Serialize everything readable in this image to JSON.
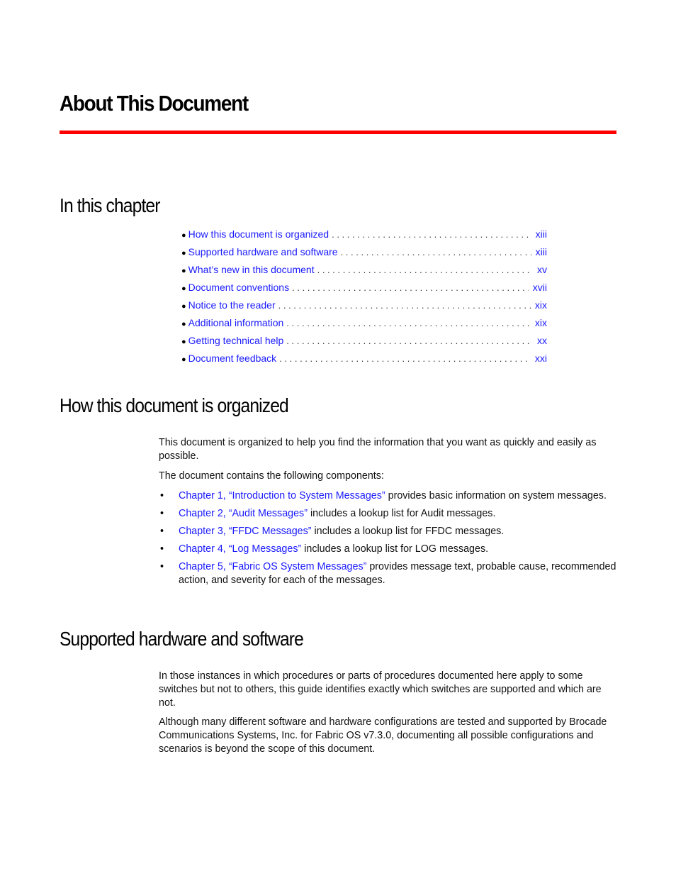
{
  "page": {
    "title": "About This Document",
    "accent_color": "#ff0000",
    "link_color": "#1a1aff"
  },
  "in_this_chapter": {
    "heading": "In this chapter",
    "items": [
      {
        "title": "How this document is organized",
        "page": "xiii"
      },
      {
        "title": "Supported hardware and software",
        "page": "xiii"
      },
      {
        "title": "What’s new in this document",
        "page": "xv"
      },
      {
        "title": "Document conventions",
        "page": "xvii"
      },
      {
        "title": "Notice to the reader",
        "page": "xix"
      },
      {
        "title": "Additional information",
        "page": "xix"
      },
      {
        "title": "Getting technical help",
        "page": "xx"
      },
      {
        "title": "Document feedback",
        "page": "xxi"
      }
    ]
  },
  "organized": {
    "heading": "How this document is organized",
    "para1": "This document is organized to help you find the information that you want as quickly and easily as possible.",
    "para2": "The document contains the following components:",
    "items": [
      {
        "link": "Chapter 1, “Introduction to System Messages”",
        "text": " provides basic information on system messages."
      },
      {
        "link": "Chapter 2, “Audit Messages”",
        "text": " includes a lookup list for Audit messages."
      },
      {
        "link": "Chapter 3, “FFDC Messages”",
        "text": " includes a lookup list for FFDC messages."
      },
      {
        "link": "Chapter 4, “Log Messages”",
        "text": " includes a lookup list for LOG messages."
      },
      {
        "link": "Chapter 5, “Fabric OS System Messages”",
        "text": " provides message text, probable cause, recommended action, and severity for each of the messages."
      }
    ]
  },
  "supported": {
    "heading": "Supported hardware and software",
    "para1": "In those instances in which procedures or parts of procedures documented here apply to some switches but not to others, this guide identifies exactly which switches are supported and which are not.",
    "para2": "Although many different software and hardware configurations are tested and supported by Brocade Communications Systems, Inc. for Fabric OS v7.3.0, documenting all possible configurations and scenarios is beyond the scope of this document."
  }
}
